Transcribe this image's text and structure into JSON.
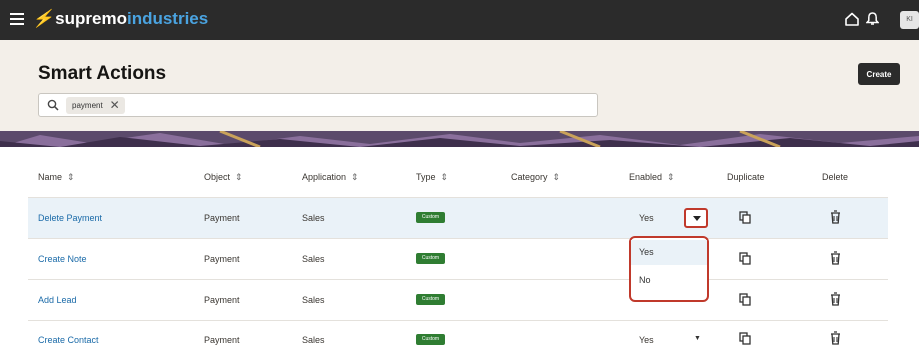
{
  "topbar": {
    "brand_part1": "supremo",
    "brand_part2": "industries",
    "avatar_text": "KI"
  },
  "page": {
    "title": "Smart Actions",
    "create_label": "Create"
  },
  "search": {
    "chip_label": "payment",
    "chip_close": "✕"
  },
  "table": {
    "headers": {
      "name": "Name",
      "object": "Object",
      "application": "Application",
      "type": "Type",
      "category": "Category",
      "enabled": "Enabled",
      "duplicate": "Duplicate",
      "delete": "Delete"
    },
    "rows": [
      {
        "name": "Delete Payment",
        "object": "Payment",
        "application": "Sales",
        "type": "Custom",
        "category": "",
        "enabled": "Yes"
      },
      {
        "name": "Create Note",
        "object": "Payment",
        "application": "Sales",
        "type": "Custom",
        "category": "",
        "enabled": ""
      },
      {
        "name": "Add Lead",
        "object": "Payment",
        "application": "Sales",
        "type": "Custom",
        "category": "",
        "enabled": ""
      },
      {
        "name": "Create Contact",
        "object": "Payment",
        "application": "Sales",
        "type": "Custom",
        "category": "",
        "enabled": "Yes"
      }
    ]
  },
  "enabled_dropdown": {
    "options": [
      "Yes",
      "No"
    ],
    "highlighted": "Yes"
  },
  "colors": {
    "topbar": "#2b2b2b",
    "brand_accent": "#4aa3e0",
    "link": "#1a6aa8",
    "badge": "#2f7d32",
    "highlight_border": "#c0392b",
    "selected_row": "#eaf2f8"
  },
  "icons": {
    "menu": "hamburger-menu-icon",
    "home": "home-icon",
    "notifications": "bell-icon",
    "search": "search-icon",
    "sort": "sort-icon",
    "duplicate": "duplicate-icon",
    "delete": "trash-icon",
    "dropdown": "chevron-down-icon"
  }
}
